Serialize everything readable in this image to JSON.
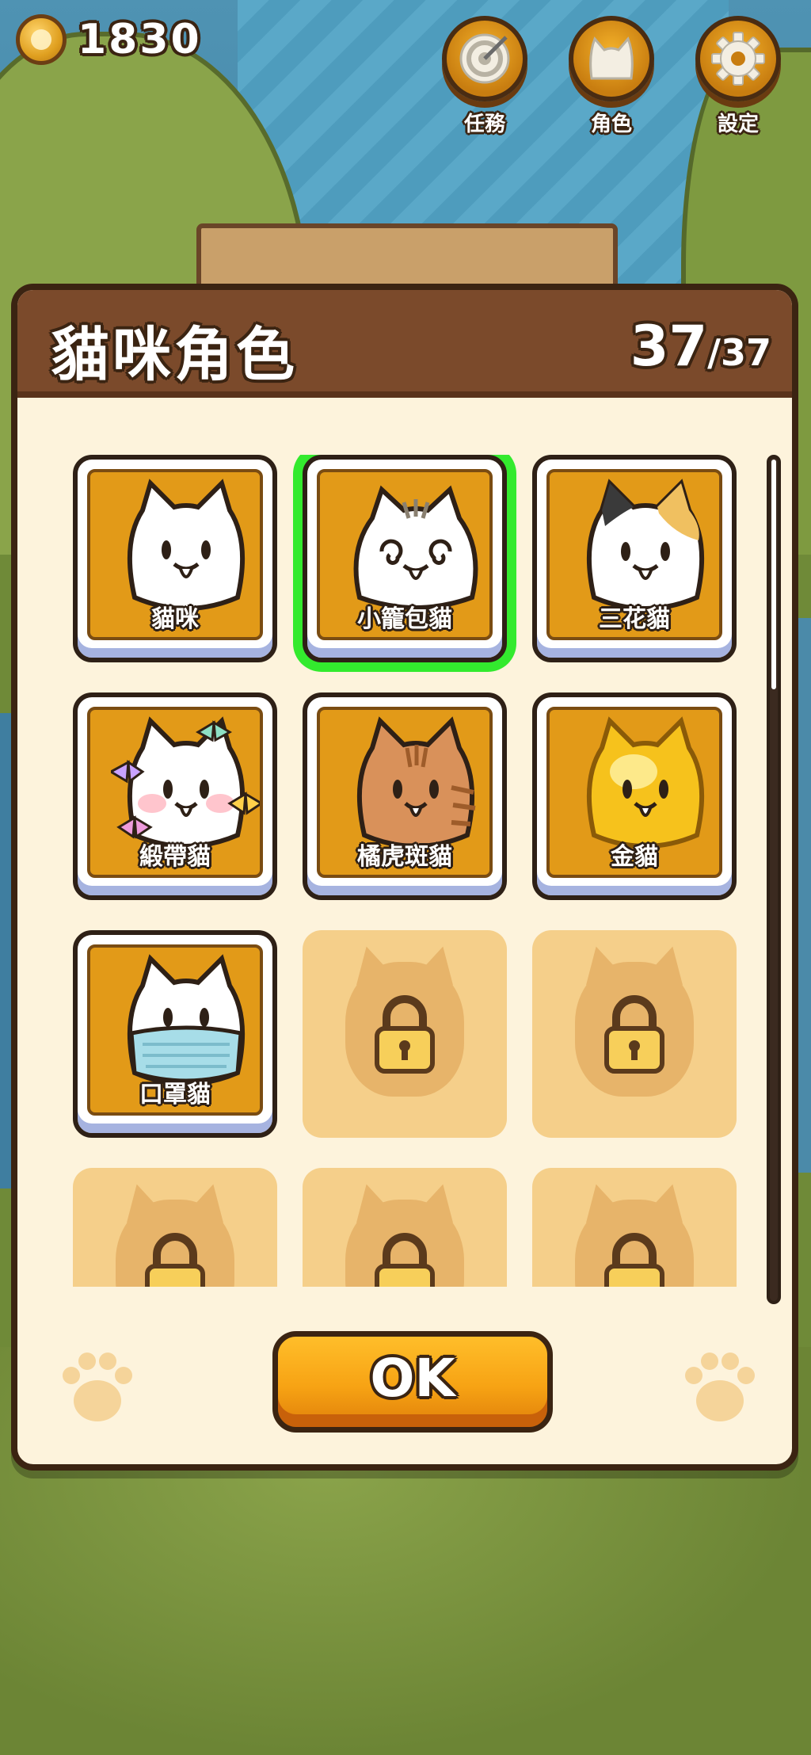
{
  "hud": {
    "coin_count": "1830",
    "buttons": [
      {
        "label": "任務",
        "icon": "target-icon"
      },
      {
        "label": "角色",
        "icon": "cat-head-icon"
      },
      {
        "label": "設定",
        "icon": "gear-icon"
      }
    ]
  },
  "modal": {
    "title": "貓咪角色",
    "count_current": "37",
    "count_total": "/37",
    "ok_label": "OK"
  },
  "characters": [
    {
      "name": "貓咪",
      "unlocked": true,
      "selected": false
    },
    {
      "name": "小籠包貓",
      "unlocked": true,
      "selected": true
    },
    {
      "name": "三花貓",
      "unlocked": true,
      "selected": false
    },
    {
      "name": "緞帶貓",
      "unlocked": true,
      "selected": false
    },
    {
      "name": "橘虎斑貓",
      "unlocked": true,
      "selected": false
    },
    {
      "name": "金貓",
      "unlocked": true,
      "selected": false
    },
    {
      "name": "口罩貓",
      "unlocked": true,
      "selected": false
    },
    {
      "name": "",
      "unlocked": false,
      "selected": false
    },
    {
      "name": "",
      "unlocked": false,
      "selected": false
    },
    {
      "name": "",
      "unlocked": false,
      "selected": false
    },
    {
      "name": "",
      "unlocked": false,
      "selected": false
    },
    {
      "name": "",
      "unlocked": false,
      "selected": false
    }
  ],
  "colors": {
    "accent": "#F7A314",
    "selected_outline": "#33EA2E",
    "header": "#7B4A2B"
  }
}
